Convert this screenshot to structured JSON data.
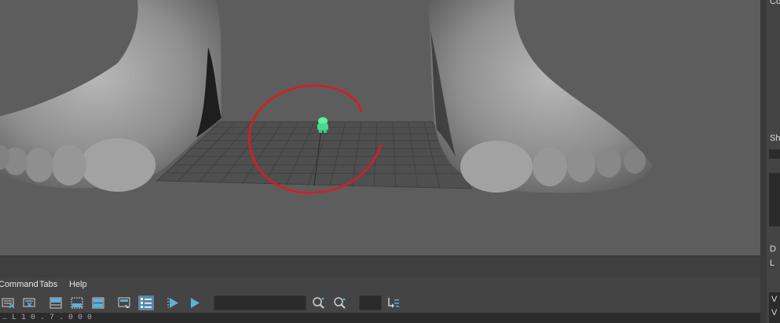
{
  "menubar": {
    "items": [
      "Command",
      "Tabs",
      "Help"
    ]
  },
  "right_panel": {
    "label_top": "Co",
    "label_mid": "Sh",
    "label_d": "D",
    "label_l": "L",
    "label_v1": "V",
    "label_v2": "V"
  },
  "script_editor": {
    "partial_text": "… L 1 0 . 7 . 0 0 0"
  },
  "colors": {
    "annotation": "#d81c24",
    "character": "#5ff0a0",
    "viewport_bg": "#5d5d5d",
    "active_button": "#5a87a8"
  },
  "icons": [
    "clear-history-icon",
    "clear-input-icon",
    "show-history-icon",
    "show-input-icon",
    "show-both-icon",
    "echo-all-icon",
    "line-numbers-icon",
    "execute-all-icon",
    "execute-icon",
    "search-next-icon",
    "search-prev-icon",
    "goto-line-icon"
  ]
}
